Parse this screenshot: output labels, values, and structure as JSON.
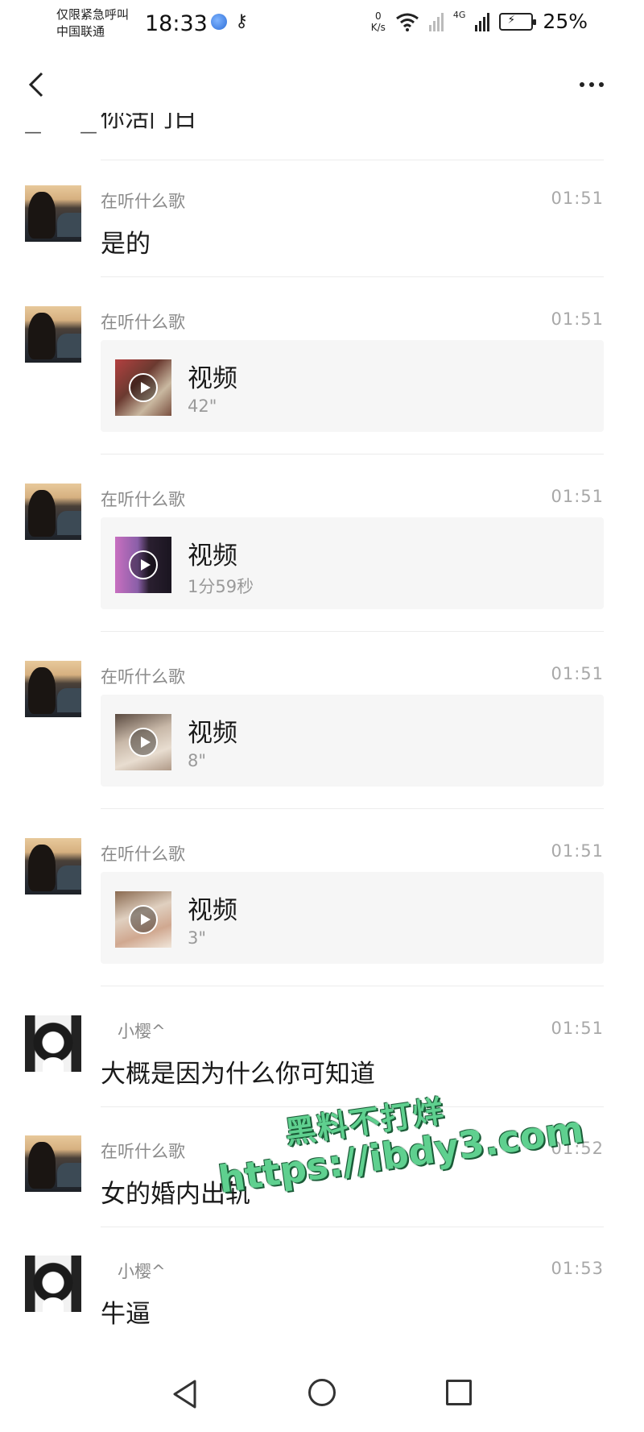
{
  "status_bar": {
    "carrier_line1": "仅限紧急呼叫",
    "carrier_line2": "中国联通",
    "time": "18:33",
    "net_speed_value": "0",
    "net_speed_unit": "K/s",
    "network_type": "4G",
    "battery_percent": "25%"
  },
  "header": {
    "back_icon": "chevron-left-icon",
    "more_icon": "more-dots-icon"
  },
  "partial_top_text": "你活门日",
  "messages": [
    {
      "sender": "在听什么歌",
      "time": "01:51",
      "kind": "text",
      "text": "是的"
    },
    {
      "sender": "在听什么歌",
      "time": "01:51",
      "kind": "video",
      "title": "视频",
      "duration": "42\""
    },
    {
      "sender": "在听什么歌",
      "time": "01:51",
      "kind": "video",
      "title": "视频",
      "duration": "1分59秒"
    },
    {
      "sender": "在听什么歌",
      "time": "01:51",
      "kind": "video",
      "title": "视频",
      "duration": "8\""
    },
    {
      "sender": "在听什么歌",
      "time": "01:51",
      "kind": "video",
      "title": "视频",
      "duration": "3\""
    },
    {
      "sender": "小樱^",
      "time": "01:51",
      "kind": "text",
      "text": "大概是因为什么你可知道"
    },
    {
      "sender": "在听什么歌",
      "time": "01:52",
      "kind": "text",
      "text": "女的婚内出轨"
    },
    {
      "sender": "小樱^",
      "time": "01:53",
      "kind": "text",
      "text": "牛逼"
    }
  ],
  "watermark": {
    "line1": "黑料不打烊",
    "line2": "https://ibdy3.com",
    "color": "#5fd08f"
  },
  "system_nav": {
    "back_icon": "triangle-back-icon",
    "home_icon": "circle-home-icon",
    "recents_icon": "square-recents-icon"
  }
}
